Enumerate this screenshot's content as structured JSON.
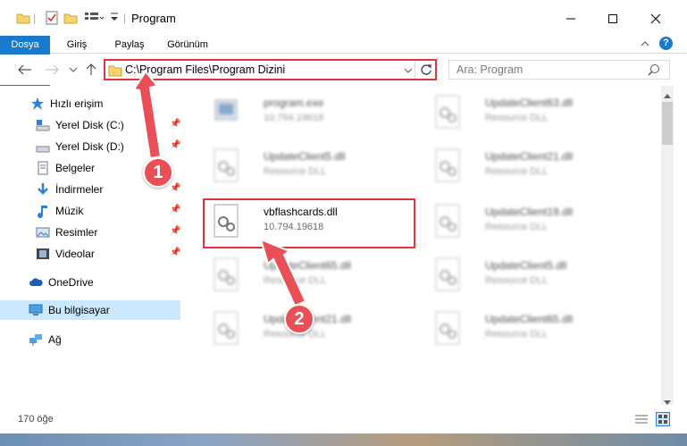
{
  "window": {
    "title": "Program"
  },
  "ribbon": {
    "tabs": [
      "Dosya",
      "Giriş",
      "Paylaş",
      "Görünüm"
    ]
  },
  "address": {
    "path": "C:\\Program Files\\Program Dizini",
    "search_placeholder": "Ara: Program"
  },
  "nav": {
    "quick_access": "Hızlı erişim",
    "items": [
      "Yerel Disk (C:)",
      "Yerel Disk (D:)",
      "Belgeler",
      "İndirmeler",
      "Müzik",
      "Resimler",
      "Videolar"
    ],
    "onedrive": "OneDrive",
    "this_pc": "Bu bilgisayar",
    "network": "Ağ"
  },
  "files": {
    "left": [
      {
        "name": "program.exe",
        "sub": "10.794.19618"
      },
      {
        "name": "UpdateClient5.dll",
        "sub": "Resource DLL"
      },
      {
        "name": "vbflashcards.dll",
        "sub": "10.794.19618"
      },
      {
        "name": "UpdateClient65.dll",
        "sub": "Resource DLL"
      },
      {
        "name": "UpdateClient21.dll",
        "sub": "Resource DLL"
      }
    ],
    "right": [
      {
        "name": "UpdateClient63.dll",
        "sub": "Resource DLL"
      },
      {
        "name": "UpdateClient21.dll",
        "sub": "Resource DLL"
      },
      {
        "name": "UpdateClient19.dll",
        "sub": "Resource DLL"
      },
      {
        "name": "UpdateClient5.dll",
        "sub": "Resource DLL"
      },
      {
        "name": "UpdateClient65.dll",
        "sub": "Resource DLL"
      }
    ]
  },
  "status": {
    "count": "170 öğe"
  },
  "annotations": {
    "step1": "1",
    "step2": "2",
    "color": "#e84f56"
  }
}
